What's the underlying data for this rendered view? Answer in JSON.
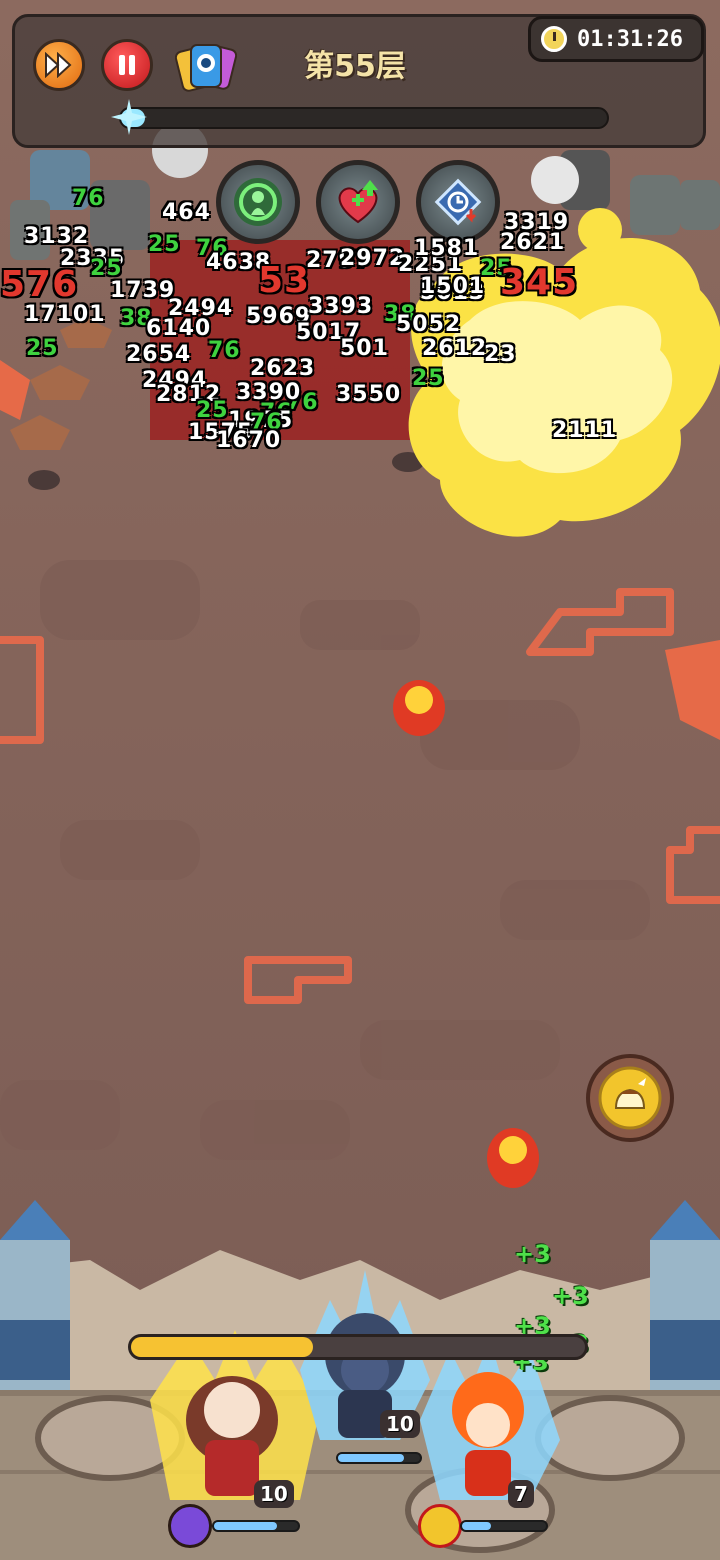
{
  "hud": {
    "floor_title": "第55层",
    "timer": "01:31:26",
    "wave_progress": 0.05,
    "fast_forward_icon": "fast-forward-icon",
    "pause_icon": "pause-icon",
    "cards_icon": "card-deck-icon"
  },
  "skills": [
    {
      "name": "spirit-summon-icon"
    },
    {
      "name": "heart-heal-icon"
    },
    {
      "name": "cooldown-reduce-icon"
    }
  ],
  "damage_numbers": [
    {
      "text": "76",
      "style": "dg"
    },
    {
      "text": "3132",
      "style": "dw"
    },
    {
      "text": "2335",
      "style": "dw"
    },
    {
      "text": "25",
      "style": "dg"
    },
    {
      "text": "464",
      "style": "dw"
    },
    {
      "text": "25",
      "style": "dg"
    },
    {
      "text": "76",
      "style": "dg"
    },
    {
      "text": "4638",
      "style": "dw"
    },
    {
      "text": "576",
      "style": "dr"
    },
    {
      "text": "1739",
      "style": "dw"
    },
    {
      "text": "17101",
      "style": "dw"
    },
    {
      "text": "2494",
      "style": "dw"
    },
    {
      "text": "38",
      "style": "dg"
    },
    {
      "text": "6140",
      "style": "dw"
    },
    {
      "text": "5969",
      "style": "dw"
    },
    {
      "text": "25",
      "style": "dg"
    },
    {
      "text": "2654",
      "style": "dw"
    },
    {
      "text": "76",
      "style": "dg"
    },
    {
      "text": "76",
      "style": "dg"
    },
    {
      "text": "2494",
      "style": "dw"
    },
    {
      "text": "2623",
      "style": "dw"
    },
    {
      "text": "2812",
      "style": "dw"
    },
    {
      "text": "3390",
      "style": "dw"
    },
    {
      "text": "25",
      "style": "dg"
    },
    {
      "text": "76",
      "style": "dg"
    },
    {
      "text": "1975",
      "style": "dw"
    },
    {
      "text": "76",
      "style": "dg"
    },
    {
      "text": "1575",
      "style": "dw"
    },
    {
      "text": "1670",
      "style": "dw"
    },
    {
      "text": "3550",
      "style": "dw"
    },
    {
      "text": "2797",
      "style": "dw"
    },
    {
      "text": "2972",
      "style": "dw"
    },
    {
      "text": "3393",
      "style": "dw"
    },
    {
      "text": "5017",
      "style": "dw"
    },
    {
      "text": "5013",
      "style": "dw"
    },
    {
      "text": "501",
      "style": "dw"
    },
    {
      "text": "38",
      "style": "dg"
    },
    {
      "text": "2251",
      "style": "dw"
    },
    {
      "text": "1581",
      "style": "dw"
    },
    {
      "text": "1501",
      "style": "dw"
    },
    {
      "text": "5052",
      "style": "dw"
    },
    {
      "text": "2612",
      "style": "dw"
    },
    {
      "text": "23",
      "style": "dw"
    },
    {
      "text": "25",
      "style": "dg"
    },
    {
      "text": "3319",
      "style": "dw"
    },
    {
      "text": "2621",
      "style": "dw"
    },
    {
      "text": "25",
      "style": "dg"
    },
    {
      "text": "345",
      "style": "dr"
    },
    {
      "text": "2111",
      "style": "dw"
    },
    {
      "text": "53",
      "style": "dr"
    }
  ],
  "heals": [
    "+3",
    "+3",
    "+3",
    "+3",
    "+3"
  ],
  "consumable": {
    "icon": "pudding-icon"
  },
  "gold_bar_progress": 0.4,
  "heroes": [
    {
      "name": "hooded-mage",
      "level": "10",
      "hp": 0.75,
      "element_icon": "arrow-slash-icon"
    },
    {
      "name": "dark-knight",
      "level": "10",
      "hp": 0.8
    },
    {
      "name": "fire-spirit",
      "level": "7",
      "hp": 0.35,
      "element_icon": "fire-ring-icon"
    }
  ]
}
